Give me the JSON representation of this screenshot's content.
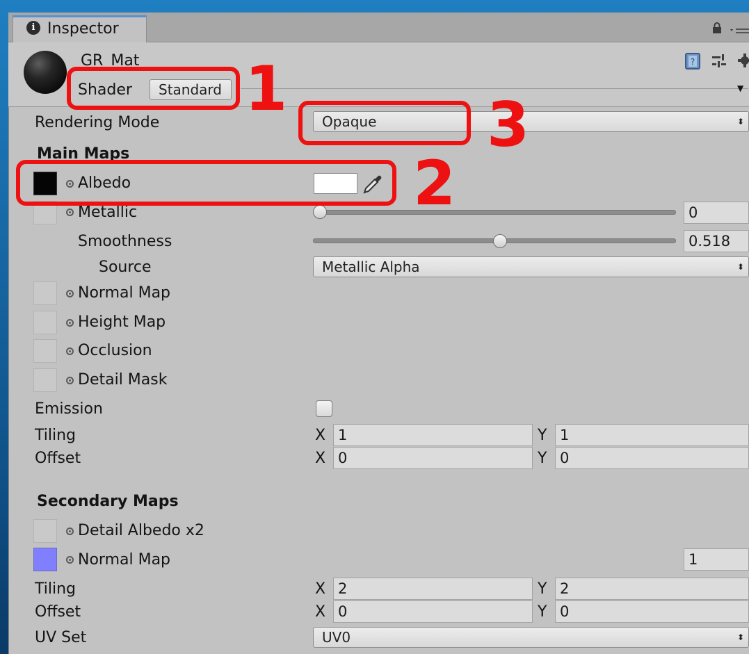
{
  "window": {
    "tab_label": "Inspector",
    "tab_icon": "info-icon"
  },
  "material": {
    "name": "GR_Mat",
    "shader_label": "Shader",
    "shader_value": "Standard"
  },
  "rendering_mode": {
    "label": "Rendering Mode",
    "value": "Opaque"
  },
  "main_maps": {
    "title": "Main Maps",
    "albedo_label": "Albedo",
    "albedo_color": "#ffffff",
    "metallic_label": "Metallic",
    "metallic_value": "0",
    "metallic_fraction": 0.0,
    "smoothness_label": "Smoothness",
    "smoothness_value": "0.518",
    "smoothness_fraction": 0.518,
    "source_label": "Source",
    "source_value": "Metallic Alpha",
    "normal_map_label": "Normal Map",
    "height_map_label": "Height Map",
    "occlusion_label": "Occlusion",
    "detail_mask_label": "Detail Mask",
    "emission_label": "Emission",
    "emission_checked": false,
    "tiling_label": "Tiling",
    "tiling_x": "1",
    "tiling_y": "1",
    "offset_label": "Offset",
    "offset_x": "0",
    "offset_y": "0",
    "x_label": "X",
    "y_label": "Y"
  },
  "secondary_maps": {
    "title": "Secondary Maps",
    "detail_albedo_label": "Detail Albedo x2",
    "normal_map_label": "Normal Map",
    "normal_map_color": "#8080ff",
    "normal_map_scale": "1",
    "tiling_label": "Tiling",
    "tiling_x": "2",
    "tiling_y": "2",
    "offset_label": "Offset",
    "offset_x": "0",
    "offset_y": "0",
    "uv_set_label": "UV Set",
    "uv_set_value": "UV0"
  },
  "annotations": {
    "shader_number": "1",
    "albedo_number": "2",
    "rendering_mode_number": "3",
    "highlight_color": "#ee1111"
  }
}
